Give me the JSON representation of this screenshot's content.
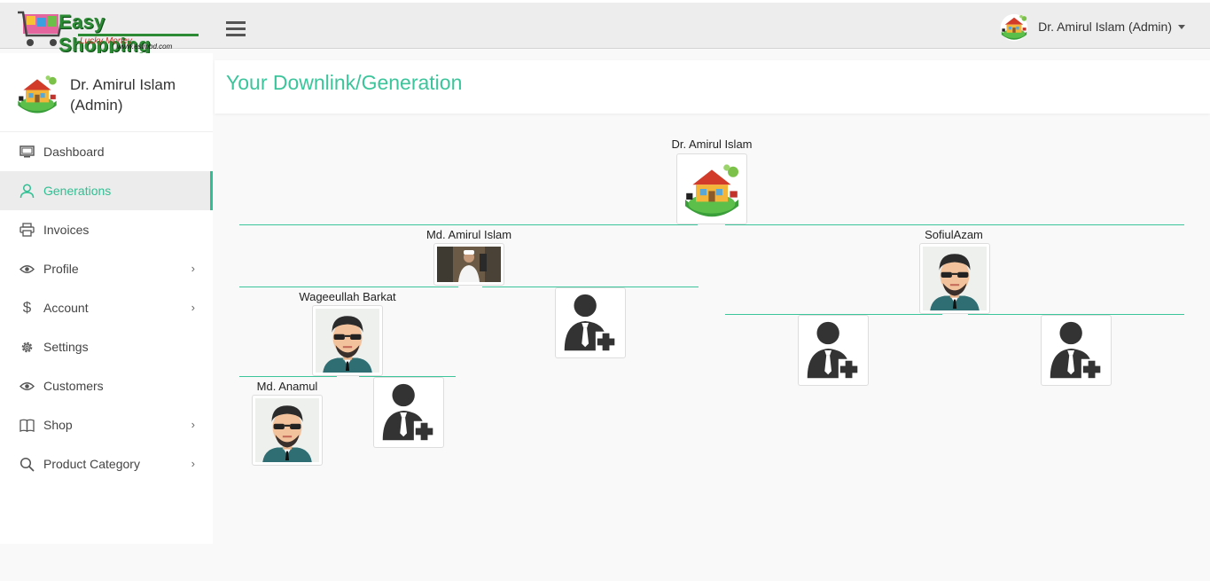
{
  "brand": {
    "name": "Easy Shopping",
    "tagline": "Lucky Money",
    "url": "www.eslmbd.com"
  },
  "header": {
    "user_label": "Dr. Amirul Islam (Admin)"
  },
  "sidebar": {
    "profile_name": "Dr. Amirul Islam (Admin)",
    "items": [
      {
        "label": "Dashboard",
        "icon": "monitor-icon",
        "active": false,
        "has_submenu": false
      },
      {
        "label": "Generations",
        "icon": "user-icon",
        "active": true,
        "has_submenu": false
      },
      {
        "label": "Invoices",
        "icon": "printer-icon",
        "active": false,
        "has_submenu": false
      },
      {
        "label": "Profile",
        "icon": "eye-icon",
        "active": false,
        "has_submenu": true
      },
      {
        "label": "Account",
        "icon": "dollar-icon",
        "active": false,
        "has_submenu": true
      },
      {
        "label": "Settings",
        "icon": "gear-icon",
        "active": false,
        "has_submenu": false
      },
      {
        "label": "Customers",
        "icon": "eye-icon",
        "active": false,
        "has_submenu": false
      },
      {
        "label": "Shop",
        "icon": "book-icon",
        "active": false,
        "has_submenu": true
      },
      {
        "label": "Product Category",
        "icon": "search-icon",
        "active": false,
        "has_submenu": true
      }
    ]
  },
  "page": {
    "title": "Your Downlink/Generation"
  },
  "tree": {
    "root": {
      "name": "Dr. Amirul Islam",
      "avatar": "house-logo-avatar"
    },
    "left": {
      "name": "Md. Amirul Islam",
      "avatar": "photo-avatar"
    },
    "right": {
      "name": "SofiulAzam",
      "avatar": "cartoon-man-avatar"
    },
    "left_left": {
      "name": "Wageeullah Barkat",
      "avatar": "cartoon-man-avatar"
    },
    "left_left_left": {
      "name": "Md. Anamul",
      "avatar": "cartoon-man-avatar"
    }
  },
  "colors": {
    "accent": "#3cc49a",
    "brand_green": "#2d8a34"
  }
}
